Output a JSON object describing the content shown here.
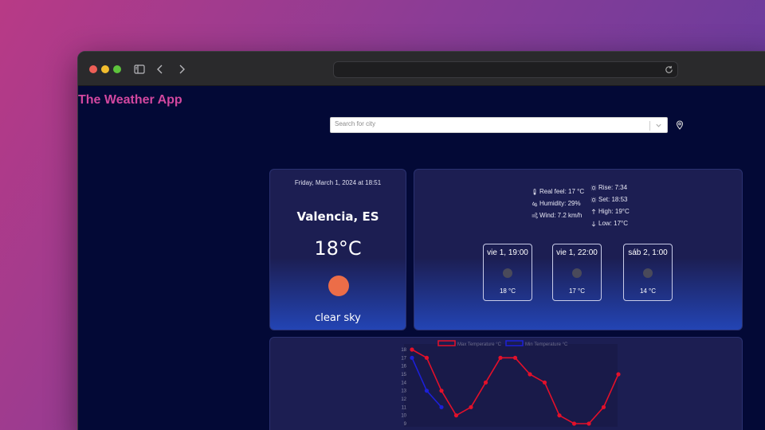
{
  "browser": {
    "traffic_lights": [
      "#ee5f57",
      "#f2bd2e",
      "#5ec43c"
    ],
    "icons": [
      "sidebar-icon",
      "back-icon",
      "forward-icon",
      "reload-icon"
    ]
  },
  "app": {
    "title": "The Weather App",
    "title_color": "#d2479f"
  },
  "search": {
    "placeholder": "Search for city",
    "icon": "location-pin-icon"
  },
  "current": {
    "date": "Friday, March 1, 2024 at 18:51",
    "city": "Valencia, ES",
    "temp": "18°C",
    "description": "clear sky",
    "icon": "sun-icon",
    "sun_color": "#ec6d48"
  },
  "details": {
    "left": [
      {
        "icon": "thermometer-icon",
        "text": "Real feel: 17 °C"
      },
      {
        "icon": "humidity-icon",
        "text": "Humidity: 29%"
      },
      {
        "icon": "wind-icon",
        "text": "Wind: 7.2 km/h"
      }
    ],
    "right": [
      {
        "icon": "sunrise-icon",
        "text": "Rise: 7:34"
      },
      {
        "icon": "sunset-icon",
        "text": "Set: 18:53"
      },
      {
        "icon": "arrow-up-icon",
        "text": "High: 19°C"
      },
      {
        "icon": "arrow-down-icon",
        "text": "Low: 17°C"
      }
    ]
  },
  "forecast": [
    {
      "time": "vie 1, 19:00",
      "temp": "18 °C"
    },
    {
      "time": "vie 1, 22:00",
      "temp": "17 °C"
    },
    {
      "time": "sáb 2, 1:00",
      "temp": "14 °C"
    }
  ],
  "chart_data": {
    "type": "line",
    "series": [
      {
        "name": "Max Temperature °C",
        "color": "#e3102a",
        "values": [
          18,
          17,
          13,
          10,
          11,
          14,
          17,
          17,
          15,
          14,
          10,
          9,
          9,
          11,
          15
        ]
      },
      {
        "name": "Min Temperature °C",
        "color": "#1c20d8",
        "values": [
          17,
          13,
          11
        ]
      }
    ],
    "y_ticks": [
      9,
      10,
      11,
      12,
      13,
      14,
      15,
      16,
      17,
      18
    ],
    "ylim": [
      9,
      18
    ],
    "grid": false,
    "legend": "top-center"
  }
}
